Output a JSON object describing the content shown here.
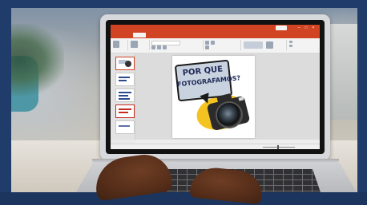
{
  "photo": {
    "subject": "laptop-with-presentation",
    "colors": {
      "frame": "#203c6b",
      "titlebar": "#d04423",
      "speech_bubble": "#c9d3e0",
      "highlight_blob": "#f2c321",
      "bubble_text": "#202a57"
    }
  },
  "app": {
    "title": "",
    "tabs": [
      "",
      "",
      "",
      "",
      "",
      "",
      "",
      ""
    ],
    "active_tab_index": 1,
    "window_controls": [
      "–",
      "□",
      "×"
    ]
  },
  "slide": {
    "heading_line1": "POR QUE",
    "heading_line2": "FOTOGRAFAMOS?"
  },
  "notes": {
    "placeholder": ""
  },
  "thumbnails": [
    {
      "num": "1",
      "selected": true
    },
    {
      "num": "2",
      "selected": false
    },
    {
      "num": "3",
      "selected": false
    },
    {
      "num": "4",
      "selected": false
    },
    {
      "num": "5",
      "selected": false
    }
  ]
}
